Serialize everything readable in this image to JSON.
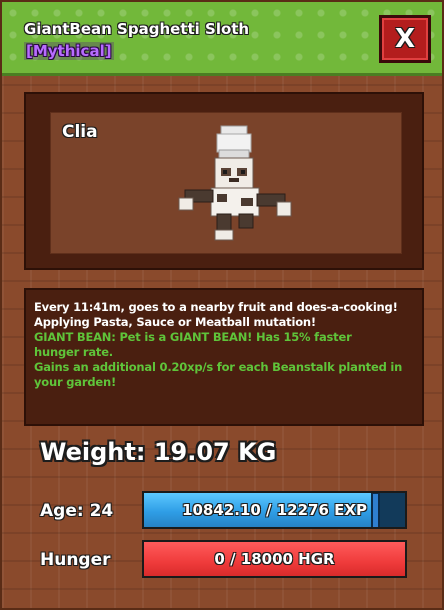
{
  "header": {
    "title": "GiantBean Spaghetti Sloth",
    "rarity": "[Mythical]",
    "close_label": "X",
    "close_icon": "close-icon"
  },
  "viewport": {
    "pet_name": "Clia",
    "pet_model_icon": "sloth-chef-model"
  },
  "description": {
    "lines": [
      {
        "text": "Every 11:41m, goes to a nearby fruit and does-a-cooking!",
        "color": "#ffffff"
      },
      {
        "text": "Applying Pasta, Sauce or Meatball mutation!",
        "color": "#ffffff"
      },
      {
        "text": "GIANT BEAN: Pet is a GIANT BEAN! Has 15% faster",
        "color": "#5fc43a"
      },
      {
        "text": "hunger rate.",
        "color": "#5fc43a"
      },
      {
        "text": "Gains an additional 0.20xp/s for each Beanstalk planted in",
        "color": "#5fc43a"
      },
      {
        "text": "your garden!",
        "color": "#5fc43a"
      }
    ]
  },
  "stats": {
    "weight": "Weight: 19.07 KG",
    "age_label": "Age: 24",
    "exp_text": "10842.10 / 12276 EXP",
    "exp_current": 10842.1,
    "exp_max": 12276,
    "hunger_label": "Hunger",
    "hunger_text": "0 / 18000 HGR",
    "hunger_current": 0,
    "hunger_max": 18000
  },
  "colors": {
    "header_green": "#72b83a",
    "rarity_purple": "#b86cff",
    "close_red": "#b31d1d",
    "panel_brown": "#8a4a2c",
    "exp_blue": "#2f9ee6",
    "hunger_red": "#ef3b3b",
    "desc_green": "#5fc43a"
  }
}
